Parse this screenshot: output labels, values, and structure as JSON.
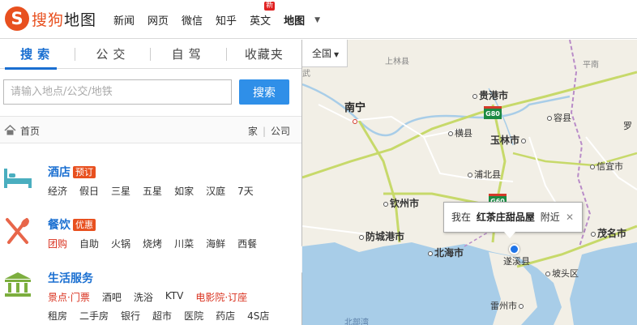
{
  "header": {
    "logo_mark": "S",
    "logo_text_a": "搜狗",
    "logo_text_b": "地图",
    "nav": [
      {
        "label": "新闻"
      },
      {
        "label": "网页"
      },
      {
        "label": "微信"
      },
      {
        "label": "知乎"
      },
      {
        "label": "英文",
        "badge": "新"
      },
      {
        "label": "地图"
      }
    ],
    "more_caret": "▼"
  },
  "tabs": [
    "搜索",
    "公交",
    "自驾",
    "收藏夹"
  ],
  "search": {
    "placeholder": "请输入地点/公交/地铁",
    "value": "",
    "button": "搜索"
  },
  "crumbs": {
    "home": "首页",
    "home_link": "家",
    "company_link": "公司"
  },
  "categories": [
    {
      "title": "酒店",
      "badge": "预订",
      "links": [
        "经济",
        "假日",
        "三星",
        "五星",
        "如家",
        "汉庭",
        "7天"
      ],
      "icon": "bed-icon"
    },
    {
      "title": "餐饮",
      "badge": "优惠",
      "links": [
        "团购",
        "自助",
        "火锅",
        "烧烤",
        "川菜",
        "海鲜",
        "西餐"
      ],
      "icon": "fork-knife-icon"
    },
    {
      "title": "生活服务",
      "links": [
        "景点·门票",
        "酒吧",
        "洗浴",
        "KTV",
        "电影院·订座"
      ],
      "links2": [
        "租房",
        "二手房",
        "银行",
        "超市",
        "医院",
        "药店",
        "4S店"
      ],
      "icon": "building-icon"
    }
  ],
  "map": {
    "region": "全国",
    "labels": {
      "nanning": "南宁",
      "guigang": "贵港市",
      "yulin": "玉林市",
      "qinzhou": "钦州市",
      "fangchenggang": "防城港市",
      "beihai": "北海市",
      "maoming": "茂名市",
      "heng": "横县",
      "rong": "容县",
      "pubei": "浦北县",
      "xinyi": "信宜市",
      "suixi": "遂溪县",
      "potou": "坡头区",
      "leizhou": "雷州市",
      "luo": "罗",
      "shanglin": "上林县",
      "beibu": "北部湾",
      "wu": "武",
      "ping": "平南"
    },
    "shield_g80": "G80",
    "shield_g60": "G60",
    "popup": {
      "prefix": "我在",
      "place": "红茶庄甜品屋",
      "suffix": "附近",
      "close": "✕"
    }
  },
  "colors": {
    "accent": "#1a6fd1",
    "brand": "#e8501f",
    "button": "#2f8fe8",
    "water": "#a8cde8",
    "land": "#f2efe6"
  }
}
